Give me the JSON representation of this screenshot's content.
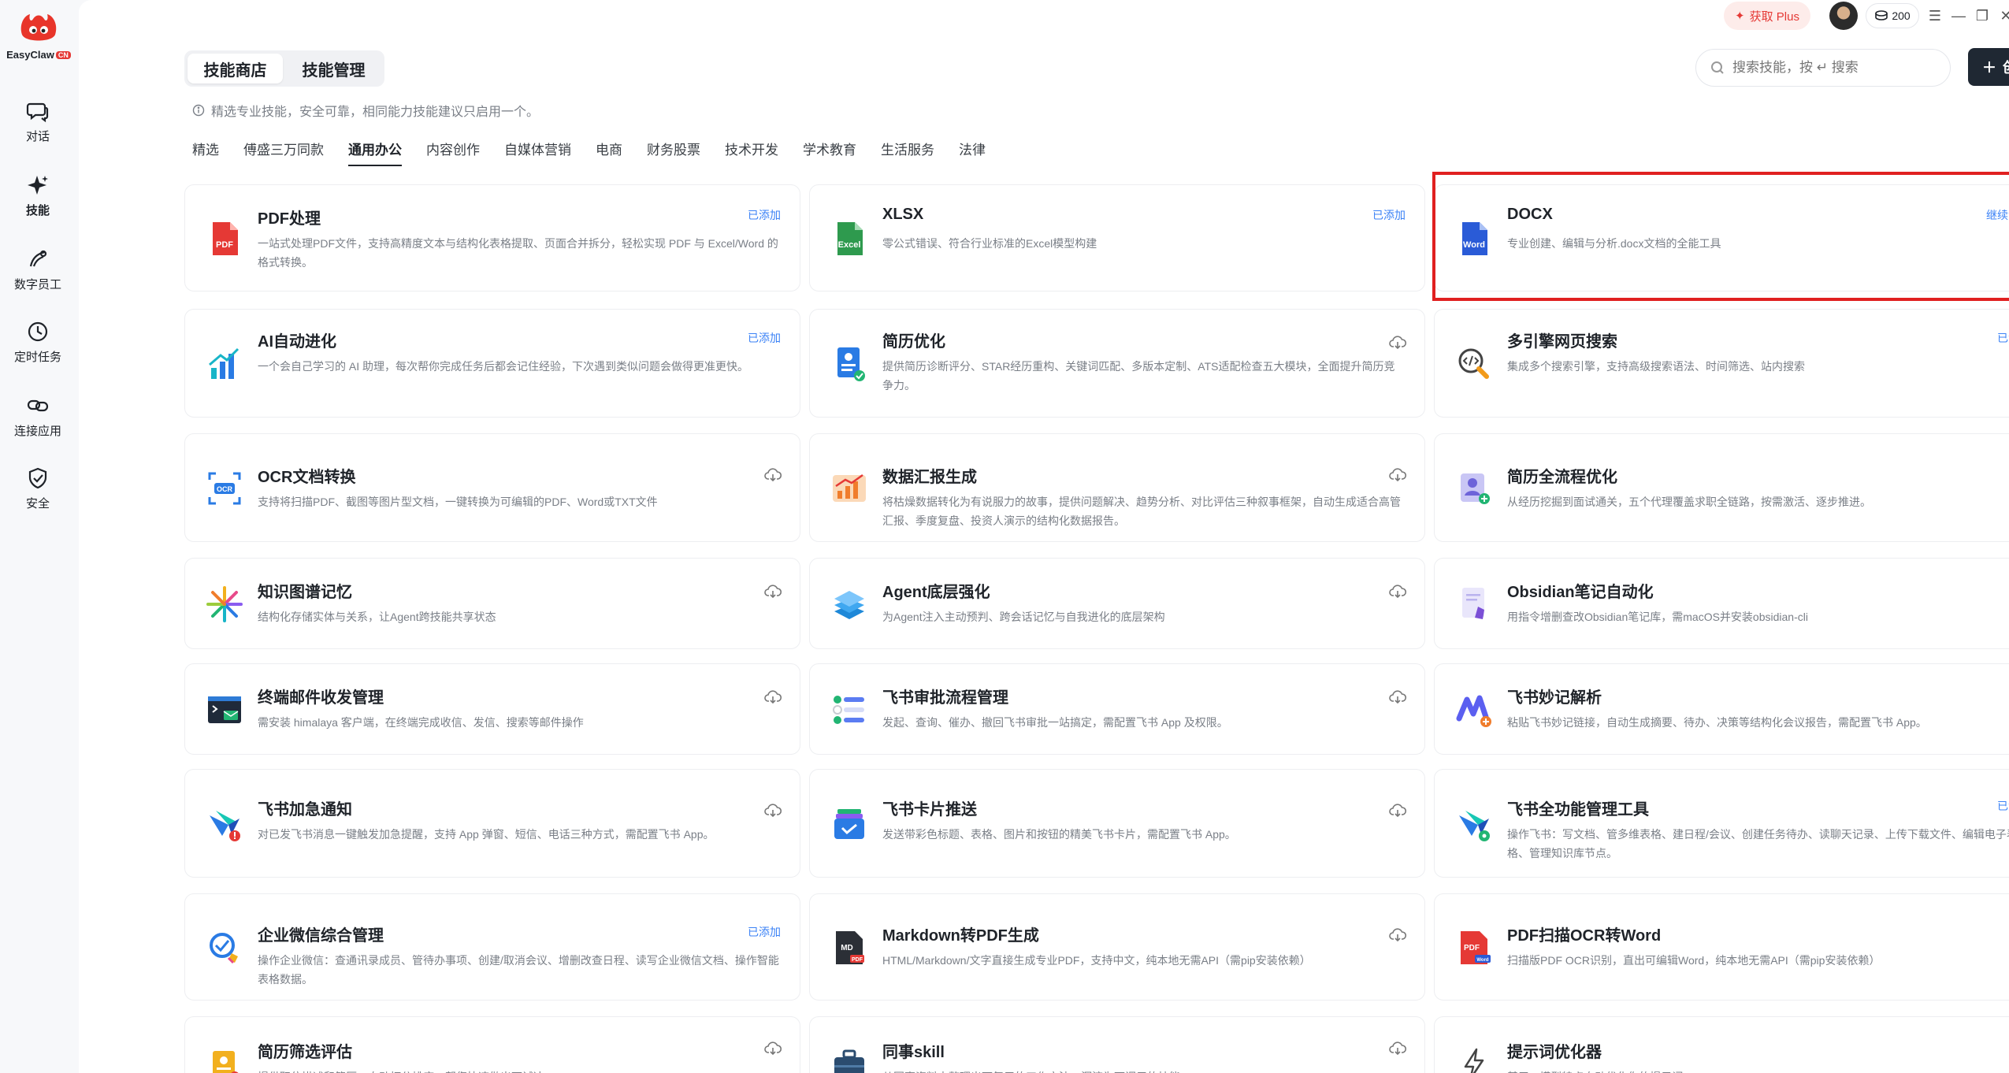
{
  "app": {
    "logo_text": "EasyClaw",
    "logo_badge": "CN"
  },
  "sidebar": {
    "items": [
      {
        "label": "对话",
        "icon": "chat-icon"
      },
      {
        "label": "技能",
        "icon": "sparkle-icon"
      },
      {
        "label": "数字员工",
        "icon": "digital-staff-icon"
      },
      {
        "label": "定时任务",
        "icon": "clock-icon"
      },
      {
        "label": "连接应用",
        "icon": "link-icon"
      },
      {
        "label": "安全",
        "icon": "shield-icon"
      }
    ]
  },
  "topbar": {
    "plus_label": "获取 Plus",
    "coins": "200"
  },
  "main_tabs": [
    "技能商店",
    "技能管理"
  ],
  "search": {
    "placeholder": "搜索技能，按 ↵ 搜索"
  },
  "create_button": "创建技能",
  "notice": "精选专业技能，安全可靠，相同能力技能建议只启用一个。",
  "categories": [
    "精选",
    "傅盛三万同款",
    "通用办公",
    "内容创作",
    "自媒体营销",
    "电商",
    "财务股票",
    "技术开发",
    "学术教育",
    "生活服务",
    "法律"
  ],
  "active_category": "通用办公",
  "cards": [
    {
      "title": "PDF处理",
      "desc": "一站式处理PDF文件，支持高精度文本与结构化表格提取、页面合并拆分，轻松实现 PDF 与 Excel/Word 的格式转换。",
      "status": "已添加",
      "icon": "pdf-icon"
    },
    {
      "title": "XLSX",
      "desc": "零公式错误、符合行业标准的Excel模型构建",
      "status": "已添加",
      "icon": "excel-icon"
    },
    {
      "title": "DOCX",
      "desc": "专业创建、编辑与分析.docx文档的全能工具",
      "status": "继续添加",
      "icon": "word-icon"
    },
    {
      "title": "AI自动进化",
      "desc": "一个会自己学习的 AI 助理，每次帮你完成任务后都会记住经验，下次遇到类似问题会做得更准更快。",
      "status": "已添加",
      "icon": "bar-chart-icon"
    },
    {
      "title": "简历优化",
      "desc": "提供简历诊断评分、STAR经历重构、关键词匹配、多版本定制、ATS适配检查五大模块，全面提升简历竞争力。",
      "status": "",
      "icon": "resume-icon"
    },
    {
      "title": "多引擎网页搜索",
      "desc": "集成多个搜索引擎，支持高级搜索语法、时间筛选、站内搜索",
      "status": "已添加",
      "icon": "code-search-icon"
    },
    {
      "title": "OCR文档转换",
      "desc": "支持将扫描PDF、截图等图片型文档，一键转换为可编辑的PDF、Word或TXT文件",
      "status": "",
      "icon": "ocr-icon"
    },
    {
      "title": "数据汇报生成",
      "desc": "将枯燥数据转化为有说服力的故事，提供问题解决、趋势分析、对比评估三种叙事框架，自动生成适合高管汇报、季度复盘、投资人演示的结构化数据报告。",
      "status": "",
      "icon": "report-chart-icon"
    },
    {
      "title": "简历全流程优化",
      "desc": "从经历挖掘到面试通关，五个代理覆盖求职全链路，按需激活、逐步推进。",
      "status": "",
      "icon": "profile-card-icon"
    },
    {
      "title": "知识图谱记忆",
      "desc": "结构化存储实体与关系，让Agent跨技能共享状态",
      "status": "",
      "icon": "starburst-icon"
    },
    {
      "title": "Agent底层强化",
      "desc": "为Agent注入主动预判、跨会话记忆与自我进化的底层架构",
      "status": "",
      "icon": "layers-icon"
    },
    {
      "title": "Obsidian笔记自动化",
      "desc": "用指令增删查改Obsidian笔记库，需macOS并安装obsidian-cli",
      "status": "",
      "icon": "obsidian-note-icon"
    },
    {
      "title": "终端邮件收发管理",
      "desc": "需安装 himalaya 客户端，在终端完成收信、发信、搜索等邮件操作",
      "status": "",
      "icon": "terminal-mail-icon"
    },
    {
      "title": "飞书审批流程管理",
      "desc": "发起、查询、催办、撤回飞书审批一站搞定，需配置飞书 App 及权限。",
      "status": "",
      "icon": "approval-list-icon"
    },
    {
      "title": "飞书妙记解析",
      "desc": "粘贴飞书妙记链接，自动生成摘要、待办、决策等结构化会议报告，需配置飞书 App。",
      "status": "",
      "icon": "minutes-icon"
    },
    {
      "title": "飞书加急通知",
      "desc": "对已发飞书消息一键触发加急提醒，支持 App 弹窗、短信、电话三种方式，需配置飞书 App。",
      "status": "",
      "icon": "feishu-alert-icon"
    },
    {
      "title": "飞书卡片推送",
      "desc": "发送带彩色标题、表格、图片和按钮的精美飞书卡片，需配置飞书 App。",
      "status": "",
      "icon": "card-stack-icon"
    },
    {
      "title": "飞书全功能管理工具",
      "desc": "操作飞书：写文档、管多维表格、建日程/会议、创建任务待办、读聊天记录、上传下载文件、编辑电子表格、管理知识库节点。",
      "status": "已添加",
      "icon": "feishu-gear-icon"
    },
    {
      "title": "企业微信综合管理",
      "desc": "操作企业微信：查通讯录成员、管待办事项、创建/取消会议、增删改查日程、读写企业微信文档、操作智能表格数据。",
      "status": "已添加",
      "icon": "wecom-icon"
    },
    {
      "title": "Markdown转PDF生成",
      "desc": "HTML/Markdown/文字直接生成专业PDF，支持中文，纯本地无需API（需pip安装依赖）",
      "status": "",
      "icon": "markdown-pdf-icon"
    },
    {
      "title": "PDF扫描OCR转Word",
      "desc": "扫描版PDF OCR识别，直出可编辑Word，纯本地无需API（需pip安装依赖）",
      "status": "",
      "icon": "pdf-word-icon"
    },
    {
      "title": "简历筛选评估",
      "desc": "提供职位描述和简历，自动打分排序，帮您快速做出面试决...",
      "status": "",
      "icon": "resume-filter-icon"
    },
    {
      "title": "同事skill",
      "desc": "从同事资料中整理出可复用的工作方法，沉淀为可调用的技能...",
      "status": "",
      "icon": "briefcase-icon"
    },
    {
      "title": "提示词优化器",
      "desc": "基于AI模型特点自动优化你的提示词...",
      "status": "",
      "icon": "lightning-icon"
    }
  ]
}
